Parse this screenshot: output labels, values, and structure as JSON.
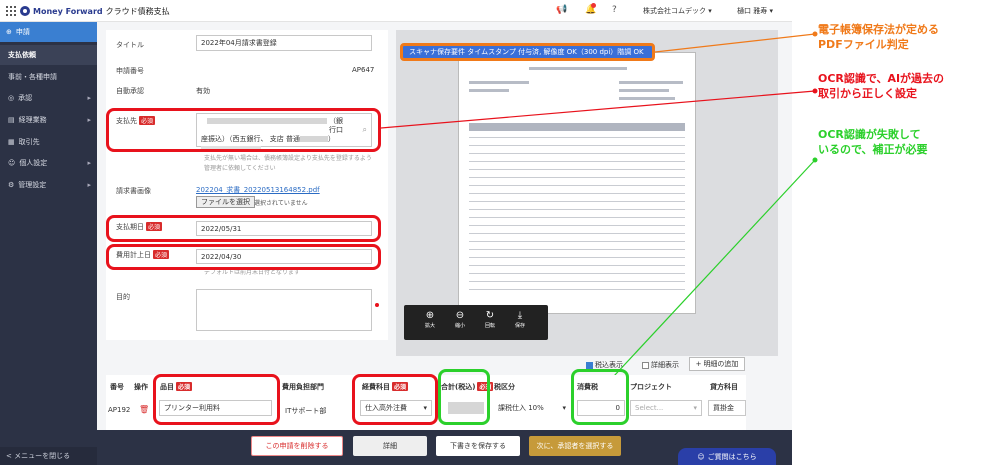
{
  "header": {
    "brand": "Money Forward",
    "product": "クラウド債務支払",
    "company": "株式会社コムデック ▾",
    "user": "樋口 雅寿 ▾"
  },
  "sidebar": {
    "apply_label": "申請",
    "items": [
      {
        "label": "支払依頼"
      },
      {
        "label": "事前・各種申請"
      },
      {
        "label": "承認"
      },
      {
        "label": "経理業務"
      },
      {
        "label": "取引先"
      },
      {
        "label": "個人設定"
      },
      {
        "label": "管理設定"
      }
    ],
    "close_label": "< メニューを閉じる"
  },
  "form": {
    "title_label": "タイトル",
    "title_value": "2022年04月請求書登録",
    "app_no_label": "申請番号",
    "app_no_value": "AP647",
    "auto_approve_label": "自動承認",
    "auto_approve_value": "有効",
    "payee_label": "支払先",
    "required": "必須",
    "payee_line1": "（銀行口",
    "payee_line2": "座振込）（西五銀行、 支店 普通",
    "payee_line3": "）",
    "payee_hint": "支払先が無い場合は、債務帳簿設定より支払先を登録するよう管理者に依頼してください",
    "invoice_label": "請求書画像",
    "invoice_file": "202204_求書_20220513164852.pdf",
    "file_button": "ファイルを選択",
    "file_none": "選択されていません",
    "due_label": "支払期日",
    "due_value": "2022/05/31",
    "expense_label": "費用計上日",
    "expense_value": "2022/04/30",
    "expense_hint": "デフォルトは前月末日付となります",
    "purpose_label": "目的"
  },
  "preview": {
    "stamp_text": "スキャナ保存要件 タイムスタンプ 付与済, 解像度 OK（300 dpi）階調 OK",
    "tools": [
      {
        "icon": "⊕",
        "label": "拡大"
      },
      {
        "icon": "⊖",
        "label": "縮小"
      },
      {
        "icon": "↻",
        "label": "回転"
      },
      {
        "icon": "⤓",
        "label": "保存"
      }
    ]
  },
  "annotations": {
    "orange": "電子帳簿保存法が定める\nPDFファイル判定",
    "red": "OCR認識で、AIが過去の\n取引から正しく設定",
    "green": "OCR認識が失敗して\nいるので、補正が必要"
  },
  "table": {
    "tax_incl": "税込表示",
    "detail": "詳細表示",
    "add_detail": "明細の追加",
    "headers": {
      "no": "番号",
      "op": "操作",
      "item": "品目",
      "dept": "費用負担部門",
      "account": "経費科目",
      "total": "合計(税込)",
      "tax_cat": "税区分",
      "tax": "消費税",
      "project": "プロジェクト",
      "debit": "貸方科目"
    },
    "row": {
      "no": "AP192",
      "item": "プリンター利用料",
      "dept": "ITサポート部",
      "account": "仕入高外注費",
      "tax_cat": "課税仕入 10%",
      "tax": "0",
      "project": "Select...",
      "debit": "買掛金"
    }
  },
  "footer": {
    "delete": "この申請を削除する",
    "detail": "詳細",
    "save_draft": "下書きを保存する",
    "next": "次に、承認者を選択する",
    "help": "ご質問はこちら"
  },
  "colors": {
    "sidebar": "#2c3245",
    "accent": "#3a7fd1",
    "red": "#e8121c",
    "green": "#2bd02b",
    "orange": "#f07a1a"
  }
}
